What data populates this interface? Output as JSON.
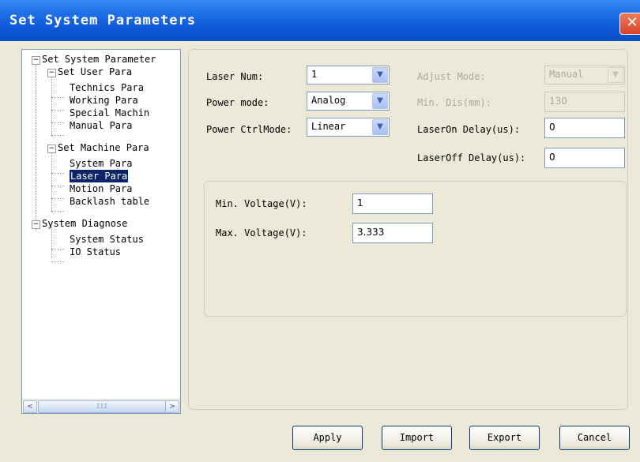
{
  "window": {
    "title": "Set System Parameters",
    "close_glyph": "✕"
  },
  "tree": {
    "nodes": [
      {
        "label": "Set System Parameter",
        "expander": "−"
      },
      {
        "label": "Set User Para",
        "expander": "−"
      },
      {
        "label": "Technics Para"
      },
      {
        "label": "Working Para"
      },
      {
        "label": "Special Machin"
      },
      {
        "label": "Manual Para"
      },
      {
        "label": "Set Machine Para",
        "expander": "−"
      },
      {
        "label": "System Para"
      },
      {
        "label": "Laser Para",
        "selected": true
      },
      {
        "label": "Motion Para"
      },
      {
        "label": "Backlash table"
      },
      {
        "label": "System Diagnose",
        "expander": "−"
      },
      {
        "label": "System Status"
      },
      {
        "label": "IO Status"
      }
    ],
    "scroll_left": "<",
    "scroll_right": ">",
    "scroll_grip": "III"
  },
  "form": {
    "laser_num": {
      "label": "Laser Num:",
      "value": "1"
    },
    "power_mode": {
      "label": "Power mode:",
      "value": "Analog"
    },
    "power_ctrl_mode": {
      "label": "Power CtrlMode:",
      "value": "Linear"
    },
    "adjust_mode": {
      "label": "Adjust Mode:",
      "value": "Manual",
      "disabled": true
    },
    "min_dis": {
      "label": "Min. Dis(mm):",
      "value": "130",
      "disabled": true
    },
    "laser_on_delay": {
      "label": "LaserOn Delay(us):",
      "value": "0"
    },
    "laser_off_delay": {
      "label": "LaserOff Delay(us):",
      "value": "0"
    },
    "min_voltage": {
      "label": "Min. Voltage(V):",
      "value": "1"
    },
    "max_voltage": {
      "label": "Max. Voltage(V):",
      "value": "3.333"
    },
    "dropdown_glyph": "▼"
  },
  "buttons": {
    "apply": "Apply",
    "import": "Import",
    "export": "Export",
    "cancel": "Cancel"
  },
  "colors": {
    "titlebar": "#0a58d6",
    "selection": "#0a246a",
    "window_bg": "#ece9d8"
  }
}
